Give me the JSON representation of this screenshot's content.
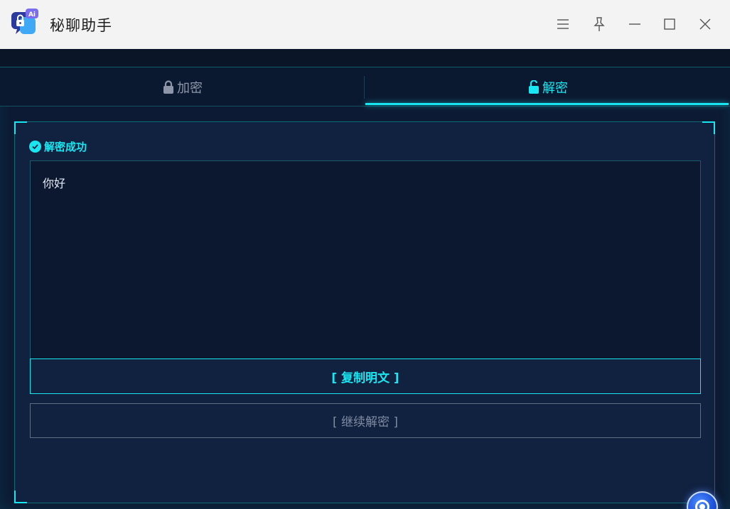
{
  "window": {
    "title": "秘聊助手",
    "app_icon_badge": "Ai",
    "controls": [
      "menu-icon",
      "pin-icon",
      "minimize-icon",
      "maximize-icon",
      "close-icon"
    ]
  },
  "tabs": [
    {
      "label": "加密",
      "icon": "lock-icon",
      "active": false
    },
    {
      "label": "解密",
      "icon": "unlock-icon",
      "active": true
    }
  ],
  "result": {
    "status_text": "解密成功",
    "status_icon": "check-circle-icon",
    "output_text": "你好"
  },
  "buttons": {
    "copy_label": "[ 复制明文 ]",
    "continue_label": "[ 继续解密 ]"
  },
  "colors": {
    "accent": "#18e6f0",
    "background": "#0c1b33",
    "panel": "#112140"
  }
}
